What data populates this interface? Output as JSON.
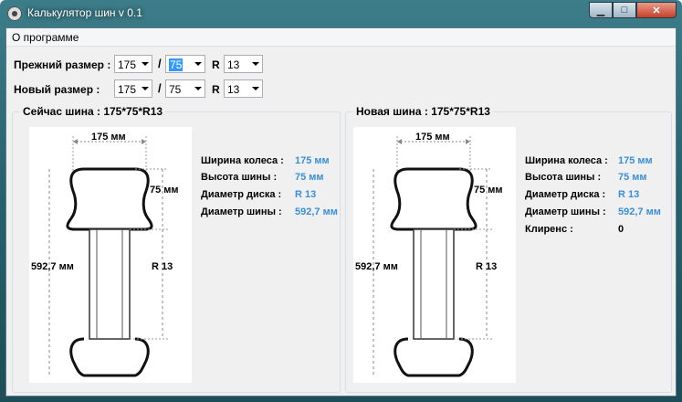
{
  "window": {
    "title": "Калькулятор шин v 0.1"
  },
  "menu": {
    "about": "О программе"
  },
  "sizes": {
    "old_label": "Прежний размер :",
    "new_label": "Новый размер :",
    "old": {
      "width": "175",
      "profile": "75",
      "rim": "13"
    },
    "new": {
      "width": "175",
      "profile": "75",
      "rim": "13"
    },
    "slash": "/",
    "rim_prefix": "R"
  },
  "current": {
    "title": "Сейчас шина : 175*75*R13",
    "diagram": {
      "width": "175 мм",
      "height": "75 мм",
      "diameter": "592,7 мм",
      "rim": "R 13"
    },
    "info": [
      {
        "label": "Ширина колеса :",
        "value": "175 мм"
      },
      {
        "label": "Высота шины :",
        "value": "75 мм"
      },
      {
        "label": "Диаметр диска :",
        "value": "R 13"
      },
      {
        "label": "Диаметр шины :",
        "value": "592,7 мм"
      }
    ]
  },
  "newtire": {
    "title": "Новая шина : 175*75*R13",
    "diagram": {
      "width": "175 мм",
      "height": "75 мм",
      "diameter": "592,7 мм",
      "rim": "R 13"
    },
    "info": [
      {
        "label": "Ширина колеса :",
        "value": "175 мм"
      },
      {
        "label": "Высота шины :",
        "value": "75 мм"
      },
      {
        "label": "Диаметр диска :",
        "value": "R 13"
      },
      {
        "label": "Диаметр шины :",
        "value": "592,7 мм"
      },
      {
        "label": "Клиренс :",
        "value": "0"
      }
    ]
  },
  "colors": {
    "accent": "#3a8fd9",
    "selection": "#3399ff"
  }
}
